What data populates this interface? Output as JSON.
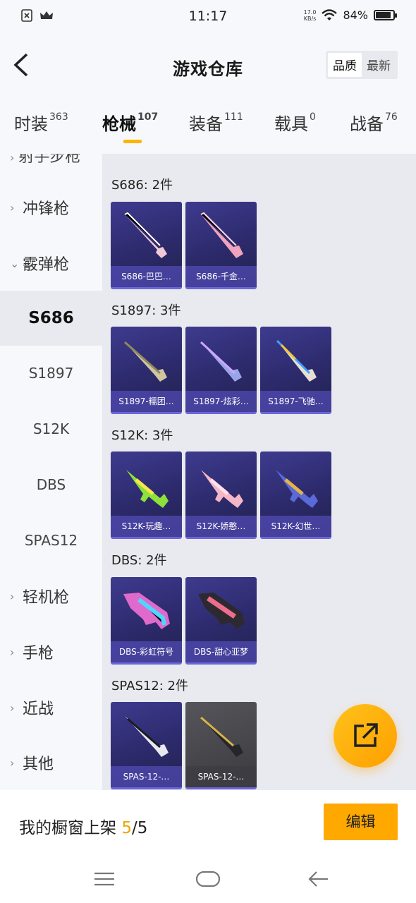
{
  "status_bar": {
    "time": "11:17",
    "net_speed_value": "17.0",
    "net_speed_unit": "KB/s",
    "battery": "84%"
  },
  "header": {
    "title": "游戏仓库",
    "sort_options": [
      "品质",
      "最新"
    ],
    "sort_active": "品质"
  },
  "tabs": [
    {
      "label": "时装",
      "count": "363"
    },
    {
      "label": "枪械",
      "count": "107",
      "active": true
    },
    {
      "label": "装备",
      "count": "111"
    },
    {
      "label": "载具",
      "count": "0"
    },
    {
      "label": "战备",
      "count": "76"
    }
  ],
  "sidebar": {
    "partial_label": "射手步枪",
    "items": [
      {
        "label": "冲锋枪",
        "type": "category",
        "expanded": false
      },
      {
        "label": "霰弹枪",
        "type": "category",
        "expanded": true
      },
      {
        "label": "S686",
        "type": "sub",
        "selected": true
      },
      {
        "label": "S1897",
        "type": "sub"
      },
      {
        "label": "S12K",
        "type": "sub"
      },
      {
        "label": "DBS",
        "type": "sub"
      },
      {
        "label": "SPAS12",
        "type": "sub"
      },
      {
        "label": "轻机枪",
        "type": "category",
        "expanded": false
      },
      {
        "label": "手枪",
        "type": "category",
        "expanded": false
      },
      {
        "label": "近战",
        "type": "category",
        "expanded": false
      },
      {
        "label": "其他",
        "type": "category",
        "expanded": false
      }
    ]
  },
  "groups": [
    {
      "title": "S686: 2件",
      "items": [
        {
          "label": "S686-巴巴…",
          "gun": "pink-white-shotgun"
        },
        {
          "label": "S686-千金…",
          "gun": "pink-shotgun"
        }
      ]
    },
    {
      "title": "S1897: 3件",
      "items": [
        {
          "label": "S1897-糯团…",
          "gun": "camo-shotgun"
        },
        {
          "label": "S1897-炫彩…",
          "gun": "purple-shotgun"
        },
        {
          "label": "S1897-飞驰…",
          "gun": "yellow-blue-shotgun"
        }
      ]
    },
    {
      "title": "S12K: 3件",
      "items": [
        {
          "label": "S12K-玩趣…",
          "gun": "green-rifle"
        },
        {
          "label": "S12K-娇憨…",
          "gun": "pink-rifle"
        },
        {
          "label": "S12K-幻世…",
          "gun": "blue-gold-rifle"
        }
      ]
    },
    {
      "title": "DBS: 2件",
      "items": [
        {
          "label": "DBS-彩虹符号",
          "gun": "rainbow-bullpup"
        },
        {
          "label": "DBS-甜心亚梦",
          "gun": "pink-black-bullpup"
        }
      ]
    },
    {
      "title": "SPAS12: 2件",
      "items": [
        {
          "label": "SPAS-12-…",
          "gun": "silver-shotgun"
        },
        {
          "label": "SPAS-12-…",
          "gun": "gold-black-shotgun",
          "gray": true
        }
      ]
    }
  ],
  "bottom": {
    "showcase_label": "我的橱窗上架",
    "showcase_current": "5",
    "showcase_sep": "/",
    "showcase_total": "5",
    "edit_label": "编辑"
  },
  "colors": {
    "accent": "#ffa800",
    "card": "#2c2a6b",
    "card_label": "#5f58d2"
  }
}
